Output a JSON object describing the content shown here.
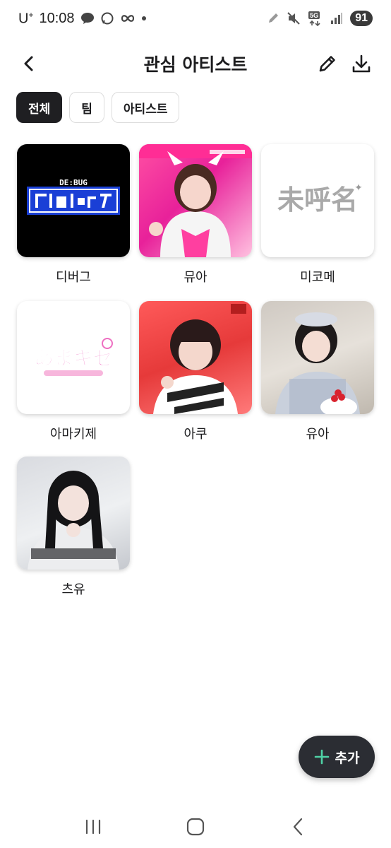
{
  "status_bar": {
    "carrier": "U",
    "carrier_sup": "+",
    "time": "10:08",
    "battery": "91",
    "network": "5G"
  },
  "header": {
    "title": "관심 아티스트"
  },
  "filters": [
    {
      "label": "전체",
      "active": true
    },
    {
      "label": "팀",
      "active": false
    },
    {
      "label": "아티스트",
      "active": false
    }
  ],
  "artists": [
    {
      "name": "디버그"
    },
    {
      "name": "뮤아"
    },
    {
      "name": "미코메"
    },
    {
      "name": "아마키제"
    },
    {
      "name": "아쿠"
    },
    {
      "name": "유아"
    },
    {
      "name": "츠유"
    }
  ],
  "logos": {
    "debug_text": "DE:BUG",
    "mikome_text": "未呼名",
    "amakize_text": "あまキゼ"
  },
  "fab": {
    "label": "추가"
  },
  "colors": {
    "accent": "#4fd1a5",
    "chip_active": "#1f1f22",
    "fab_bg": "#2b2d33"
  }
}
